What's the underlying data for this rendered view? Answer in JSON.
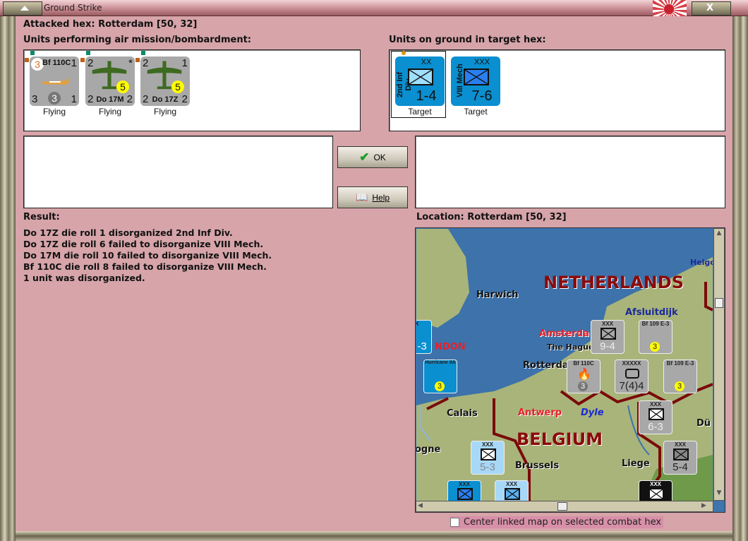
{
  "window": {
    "title": "Ground Strike"
  },
  "attacked_hex": "Attacked hex: Rotterdam  [50, 32]",
  "air_units_label": "Units performing air mission/bombardment:",
  "ground_units_label": "Units on ground in target hex:",
  "air_units": [
    {
      "name": "Bf 110C",
      "tl": "3",
      "tr": "1",
      "bl": "3",
      "br": "1",
      "circle": "3",
      "status": "Flying"
    },
    {
      "name": "Do 17M",
      "tl": "2",
      "tr": "*",
      "bl": "2",
      "br": "2",
      "circle": "5",
      "status": "Flying"
    },
    {
      "name": "Do 17Z",
      "tl": "2",
      "tr": "1",
      "bl": "2",
      "br": "2",
      "circle": "5",
      "status": "Flying"
    }
  ],
  "ground_units": [
    {
      "name": "2nd Inf Div",
      "size": "XX",
      "value": "1-4",
      "status": "Target",
      "color": "#0a8fd0"
    },
    {
      "name": "VIII Mech",
      "size": "XXX",
      "value": "7-6",
      "status": "Target",
      "color": "#0a8fd0"
    }
  ],
  "buttons": {
    "ok": "OK",
    "help": "Help"
  },
  "result_label": "Result:",
  "results": [
    "Do 17Z die roll 1 disorganized 2nd Inf Div.",
    "Do 17Z die roll 6 failed to disorganize VIII Mech.",
    "Do 17M die roll 10 failed to disorganize VIII Mech.",
    "Bf 110C die roll 8 failed to disorganize VIII Mech.",
    "1 unit was disorganized."
  ],
  "location_label": "Location:  Rotterdam  [50, 32]",
  "map": {
    "labels": {
      "helgo": "Helgo",
      "harwich": "Harwich",
      "netherlands": "NETHERLANDS",
      "afsluitdijk": "Afsluitdijk",
      "amsterdam": "Amsterda",
      "hague": "The Hague",
      "rotterdam": "Rotterdam",
      "london": "NDON",
      "calais": "Calais",
      "antwerp": "Antwerp",
      "dyle": "Dyle",
      "belgium": "BELGIUM",
      "brussels": "Brussels",
      "liege": "Liege",
      "boulogne": "ogne",
      "dusseldorf": "Dü"
    },
    "counters": [
      {
        "size": "XXX",
        "value": "9-4"
      },
      {
        "size": "Bf 109 E-3",
        "value": "3"
      },
      {
        "size": "Bf 110C",
        "value": "3"
      },
      {
        "size": "XXXXX",
        "value": "7(4)4"
      },
      {
        "size": "Bf 109 E-3",
        "value": "3"
      },
      {
        "size": "Hurricane IIA",
        "value": "3"
      },
      {
        "size": "XXX",
        "value": "6-3"
      },
      {
        "size": "XXX",
        "value": "5-3"
      },
      {
        "size": "XXX",
        "value": "5-4"
      },
      {
        "size": "XX",
        "value": "-3"
      },
      {
        "size": "XXX",
        "value": ""
      },
      {
        "size": "XXX",
        "value": ""
      },
      {
        "size": "XXX",
        "value": ""
      }
    ]
  },
  "center_checkbox": {
    "label": "Center linked map on selected combat hex",
    "checked": false
  }
}
